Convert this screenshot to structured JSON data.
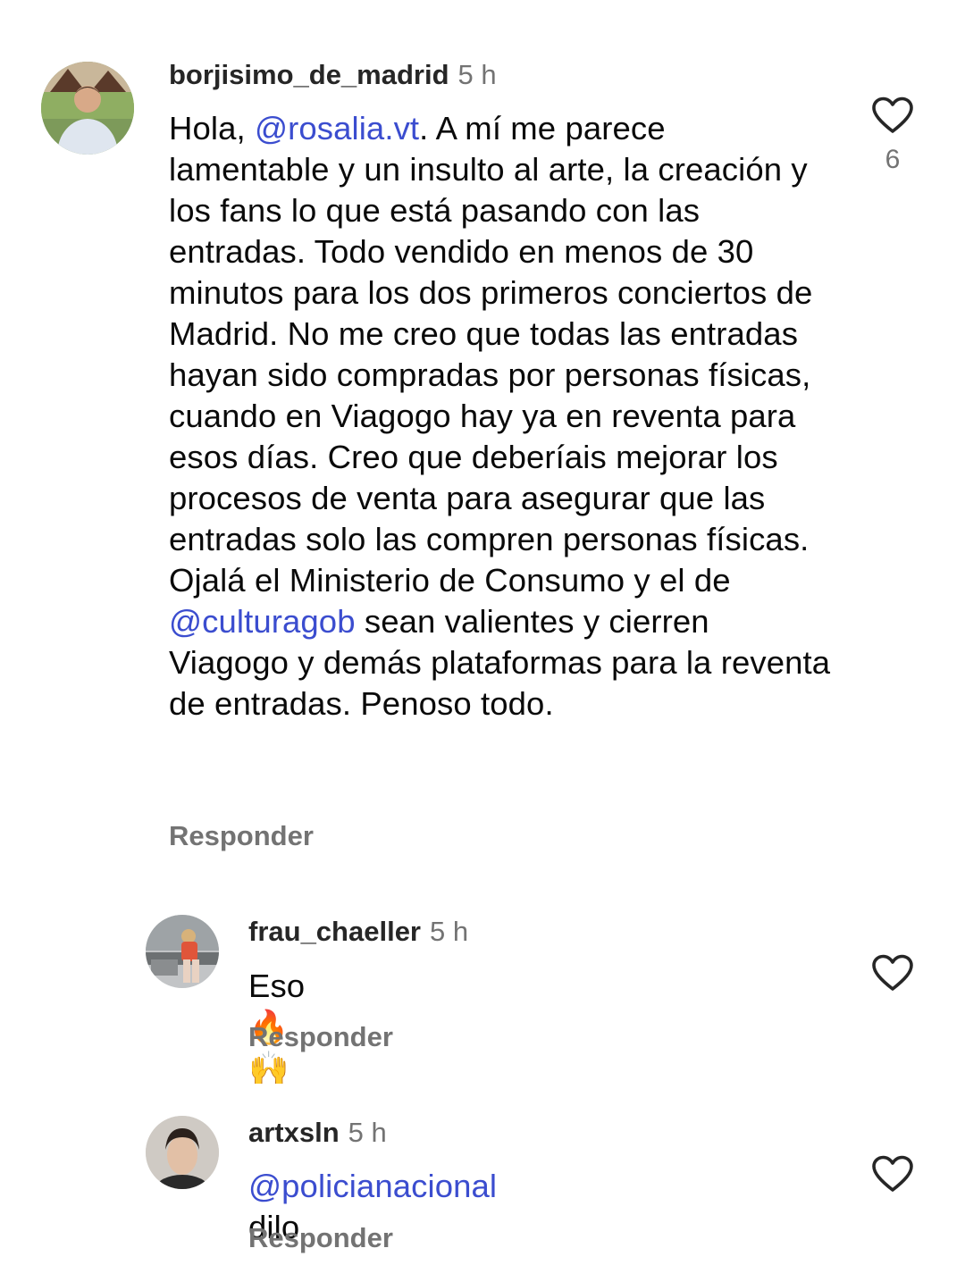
{
  "comments": [
    {
      "username": "borjisimo_de_madrid",
      "time": "5 h",
      "text_before": "Hola, ",
      "mention1": "rosalia.vt",
      "text_middle": ". A mí me parece lamentable y un insulto al arte, la creación y los fans lo que está pasando con las entradas. Todo vendido en menos de 30 minutos para los dos primeros conciertos de Madrid. No me creo que todas las entradas hayan sido compradas por personas físicas, cuando en Viagogo hay ya en reventa para esos días. Creo que deberíais mejorar los procesos de venta para asegurar que las entradas solo las compren personas físicas. Ojalá el Ministerio de Consumo y el de ",
      "mention2": "culturagob",
      "text_after": " sean valientes y cierren Viagogo y demás plataformas para la reventa de entradas. Penoso todo.",
      "likes": "6",
      "reply_label": "Responder"
    },
    {
      "username": "frau_chaeller",
      "time": "5 h",
      "text": "Eso ",
      "emojis": "🔥🙌",
      "reply_label": "Responder"
    },
    {
      "username": "artxsln",
      "time": "5 h",
      "mention": "policianacional",
      "text_after": " dilo",
      "reply_label": "Responder"
    }
  ],
  "mention_symbol": "@",
  "icons": {
    "like": "heart-outline-icon"
  },
  "colors": {
    "mention": "#3b4dcf",
    "muted": "#737373",
    "text": "#0a0a0a"
  }
}
